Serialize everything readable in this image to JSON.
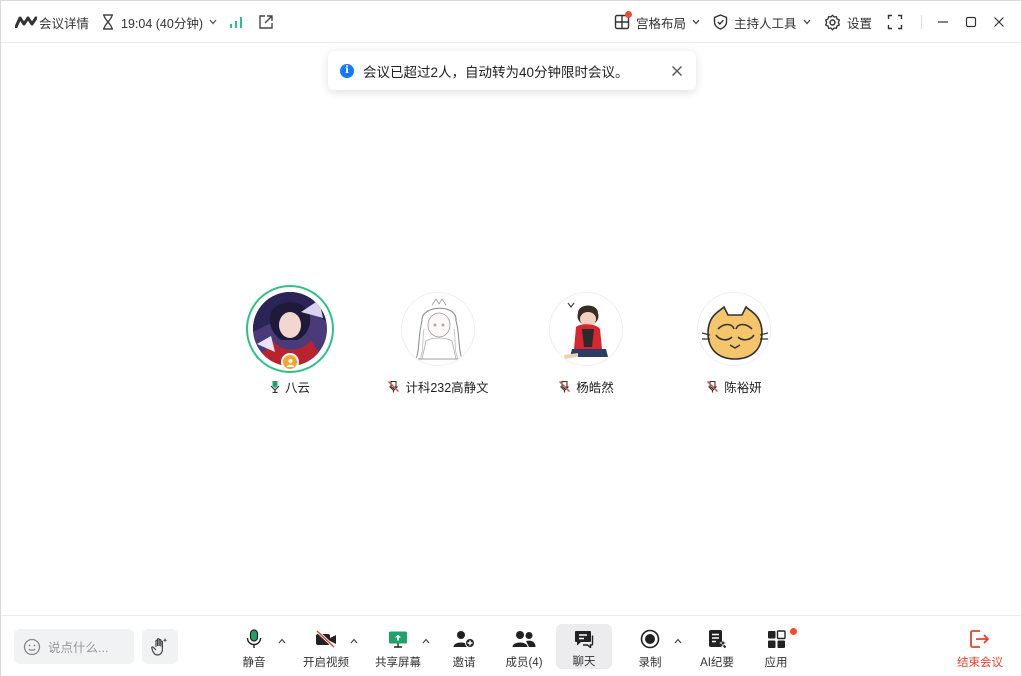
{
  "titlebar": {
    "meeting_info_label": "会议详情",
    "timer_text": "19:04 (40分钟)",
    "layout_label": "宫格布局",
    "host_tools_label": "主持人工具",
    "settings_label": "设置"
  },
  "toast": {
    "message": "会议已超过2人，自动转为40分钟限时会议。"
  },
  "participants": [
    {
      "name": "八云",
      "mic": "on",
      "is_host": true,
      "speaking": true
    },
    {
      "name": "计科232高静文",
      "mic": "muted",
      "is_host": false,
      "speaking": false
    },
    {
      "name": "杨皓然",
      "mic": "muted",
      "is_host": false,
      "speaking": false
    },
    {
      "name": "陈裕妍",
      "mic": "muted",
      "is_host": false,
      "speaking": false
    }
  ],
  "bottombar": {
    "chat_placeholder": "说点什么...",
    "tools": {
      "mute": "静音",
      "video": "开启视频",
      "share": "共享屏幕",
      "invite": "邀请",
      "members": "成员(4)",
      "chat": "聊天",
      "record": "录制",
      "ai_notes": "AI纪要",
      "apps": "应用",
      "end": "结束会议"
    }
  },
  "colors": {
    "accent_green": "#2bc28a",
    "info_blue": "#1677ff",
    "end_red": "#e7402b",
    "badge_orange": "#f2a533",
    "notify_dot": "#f5492b"
  }
}
